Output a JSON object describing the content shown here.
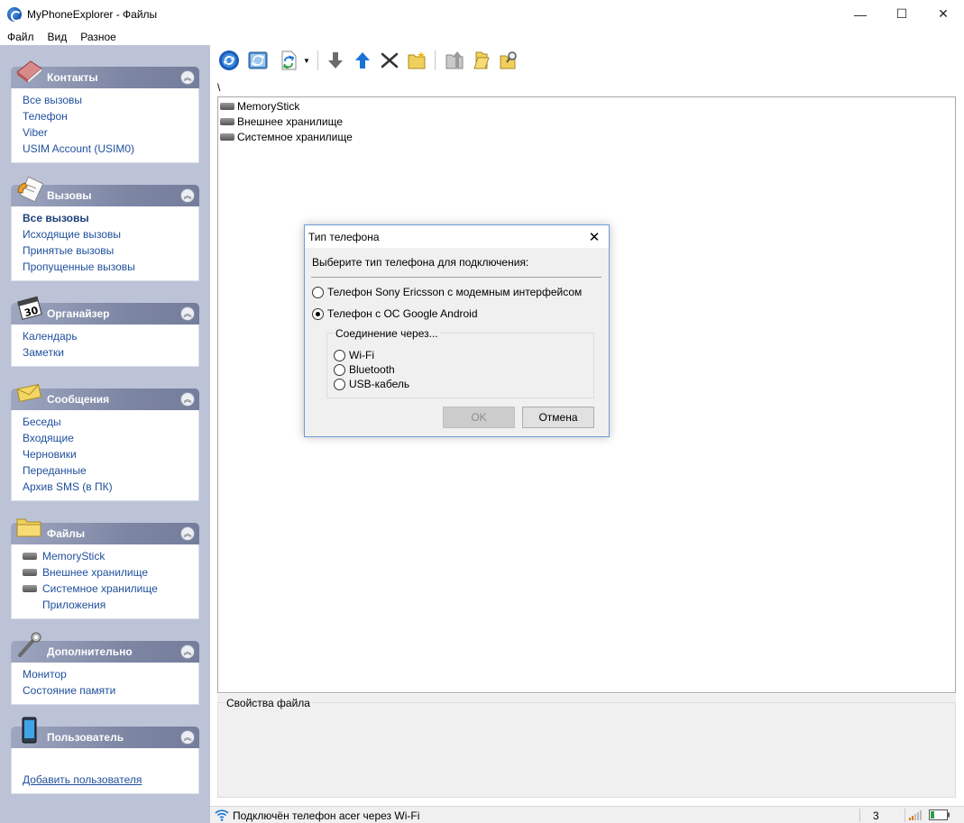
{
  "window": {
    "title": "MyPhoneExplorer -  Файлы",
    "minimize": "—",
    "maximize": "☐",
    "close": "✕"
  },
  "menu": [
    "Файл",
    "Вид",
    "Разное"
  ],
  "sidebar": {
    "contacts": {
      "title": "Контакты",
      "items": [
        "Все вызовы",
        "Телефон",
        "Viber",
        "USIM Account (USIM0)"
      ]
    },
    "calls": {
      "title": "Вызовы",
      "items": [
        "Все вызовы",
        "Исходящие вызовы",
        "Принятые вызовы",
        "Пропущенные вызовы"
      ]
    },
    "organizer": {
      "title": "Органайзер",
      "icon_text": "30",
      "items": [
        "Календарь",
        "Заметки"
      ]
    },
    "messages": {
      "title": "Сообщения",
      "items": [
        "Беседы",
        "Входящие",
        "Черновики",
        "Переданные",
        "Архив SMS (в ПК)"
      ]
    },
    "files": {
      "title": "Файлы",
      "items": [
        "MemoryStick",
        "Внешнее хранилище",
        "Системное хранилище",
        "Приложения"
      ]
    },
    "extra": {
      "title": "Дополнительно",
      "items": [
        "Монитор",
        "Состояние памяти"
      ]
    },
    "user": {
      "title": "Пользователь",
      "items": [
        "Добавить пользователя"
      ]
    }
  },
  "path": "\\",
  "file_list": [
    "MemoryStick",
    "Внешнее хранилище",
    "Системное хранилище"
  ],
  "properties_label": "Свойства файла",
  "status": {
    "text": "Подключён телефон acer через Wi-Fi",
    "count": "3"
  },
  "dialog": {
    "title": "Тип телефона",
    "prompt": "Выберите тип телефона для подключения:",
    "option_sony": "Телефон Sony Ericsson с модемным интерфейсом",
    "option_android": "Телефон с ОС Google Android",
    "selected": "android",
    "group_label": "Соединение через...",
    "connections": [
      "Wi-Fi",
      "Bluetooth",
      "USB-кабель"
    ],
    "ok": "OK",
    "cancel": "Отмена",
    "close": "✕"
  },
  "colors": {
    "sidebar_bg": "#bcc3d6",
    "link": "#1f4f9c",
    "accent_blue": "#1a73d8"
  }
}
